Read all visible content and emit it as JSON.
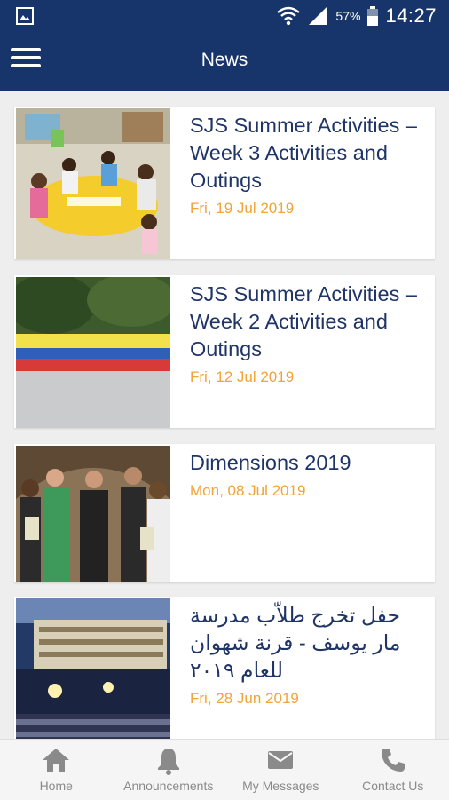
{
  "status": {
    "battery": "57%",
    "time": "14:27"
  },
  "app_bar": {
    "title": "News"
  },
  "news": [
    {
      "title": "SJS Summer Activities – Week 3 Activities and Outings",
      "date": "Fri, 19 Jul 2019",
      "image": "children-at-table"
    },
    {
      "title": "SJS Summer Activities – Week 2 Activities and Outings",
      "date": "Fri, 12 Jul 2019",
      "image": "group-on-court"
    },
    {
      "title": "Dimensions 2019",
      "date": "Mon, 08 Jul 2019",
      "image": "group-portrait"
    },
    {
      "title": "حفل تخرج طلاّب مدرسة مار يوسف - قرنة شهوان للعام ٢٠١٩",
      "date": "Fri, 28 Jun 2019",
      "image": "graduation-ceremony"
    }
  ],
  "bottom_nav": [
    {
      "label": "Home",
      "icon": "home-icon"
    },
    {
      "label": "Announcements",
      "icon": "bell-icon"
    },
    {
      "label": "My Messages",
      "icon": "envelope-icon"
    },
    {
      "label": "Contact Us",
      "icon": "phone-icon"
    }
  ],
  "colors": {
    "primary": "#18356b",
    "title_text": "#1f3467",
    "date_text": "#f1a437"
  }
}
